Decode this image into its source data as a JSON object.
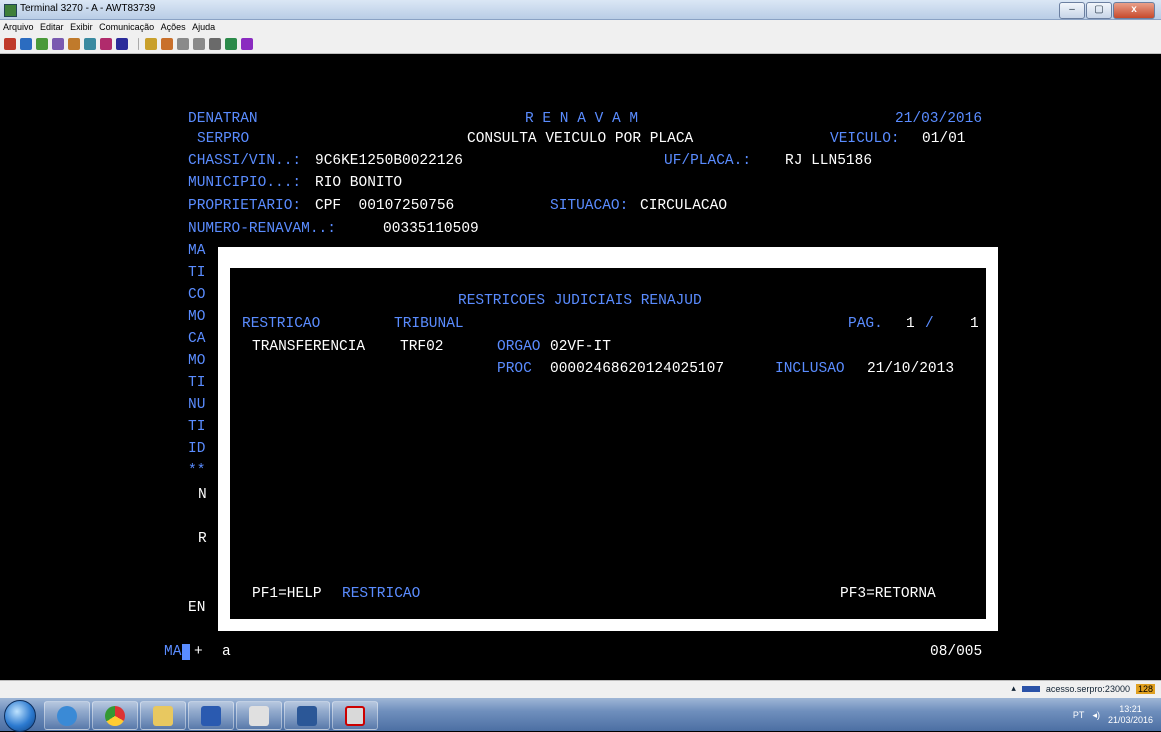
{
  "window": {
    "title": "Terminal 3270 - A - AWT83739",
    "minimize": "–",
    "maximize": "▢",
    "close": "x"
  },
  "menu": [
    "Arquivo",
    "Editar",
    "Exibir",
    "Comunicação",
    "Ações",
    "Ajuda"
  ],
  "screen": {
    "org": "DENATRAN",
    "system": "R E N A V A M",
    "date": "21/03/2016",
    "subsystem": "SERPRO",
    "transaction": "CONSULTA VEICULO POR PLACA",
    "veiculo_label": "VEICULO:",
    "veiculo_value": "01/01",
    "chassi_label": "CHASSI/VIN..:",
    "chassi_value": "9C6KE1250B0022126",
    "uf_placa_label": "UF/PLACA.:",
    "uf_placa_value": "RJ LLN5186",
    "municipio_label": "MUNICIPIO...:",
    "municipio_value": "RIO BONITO",
    "proprietario_label": "PROPRIETARIO:",
    "proprietario_value": "CPF  00107250756",
    "situacao_label": "SITUACAO:",
    "situacao_value": "CIRCULACAO",
    "renavam_label": "NUMERO-RENAVAM..:",
    "renavam_value": "00335110509",
    "left_fragments": [
      "MA",
      "TI",
      "CO",
      "MO",
      "CA",
      "MO",
      "TI",
      "NU",
      "TI",
      "ID",
      "**"
    ],
    "n_fragment": "N",
    "r_fragment": "R",
    "en_fragment": "EN",
    "cmd_prefix": "MA",
    "cmd_plus": "+",
    "cmd_input": "a",
    "cursor_pos": "08/005"
  },
  "popup": {
    "title": "RESTRICOES JUDICIAIS RENAJUD",
    "col_restricao": "RESTRICAO",
    "col_tribunal": "TRIBUNAL",
    "pag_label": "PAG.",
    "pag_current": "1",
    "pag_sep": "/",
    "pag_total": "1",
    "restricao": "TRANSFERENCIA",
    "tribunal": "TRF02",
    "orgao_label": "ORGAO",
    "orgao_value": "02VF-IT",
    "proc_label": "PROC",
    "proc_value": "00002468620124025107",
    "inclusao_label": "INCLUSAO",
    "inclusao_value": "21/10/2013",
    "pf1": "PF1=HELP",
    "pf1_context": "RESTRICAO",
    "pf3": "PF3=RETORNA"
  },
  "status": {
    "host": "acesso.serpro:23000",
    "count": "128"
  },
  "tray": {
    "lang": "PT",
    "time": "13:21",
    "date": "21/03/2016"
  },
  "colors": {
    "field_label": "#5a8cff",
    "field_value": "#ffffff",
    "background": "#000000"
  }
}
